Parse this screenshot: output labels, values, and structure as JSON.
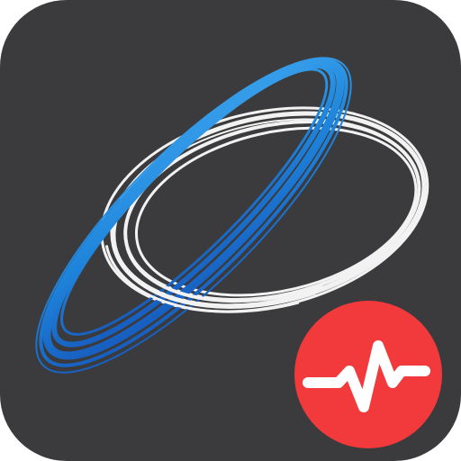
{
  "icon": {
    "name": "app-icon",
    "depicts": "orbit-rings-icon",
    "badge": "heartbeat-pulse-icon"
  },
  "colors": {
    "tile_background": "#3b3b3d",
    "ring_white": "#f2f2f2",
    "ring_blue_light": "#3fa6f0",
    "ring_blue_mid": "#1f86dc",
    "ring_blue_dark": "#1452b8",
    "badge_red": "#f23a3c",
    "pulse_white": "#ffffff"
  }
}
